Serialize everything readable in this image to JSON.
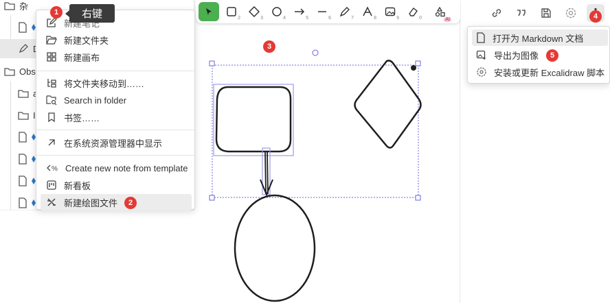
{
  "left_tree": {
    "rows": [
      {
        "label": "杂"
      },
      {
        "label": ""
      },
      {
        "label": "D"
      },
      {
        "label": "Obs"
      },
      {
        "label": "a"
      },
      {
        "label": "In"
      },
      {
        "label": ""
      },
      {
        "label": ""
      },
      {
        "label": ""
      },
      {
        "label": ""
      }
    ]
  },
  "tooltip": {
    "text": "右键"
  },
  "context_menu": {
    "items": [
      {
        "label": "新建笔记",
        "icon": "edit-icon"
      },
      {
        "label": "新建文件夹",
        "icon": "folder-open-icon"
      },
      {
        "label": "新建画布",
        "icon": "grid-icon"
      },
      {
        "label": "将文件夹移动到……",
        "icon": "move-folder-icon"
      },
      {
        "label": "Search in folder",
        "icon": "folder-search-icon"
      },
      {
        "label": "书签……",
        "icon": "bookmark-icon"
      },
      {
        "label": "在系统资源管理器中显示",
        "icon": "arrow-up-right-icon"
      },
      {
        "label": "Create new note from template",
        "icon": "template-icon"
      },
      {
        "label": "新看板",
        "icon": "kanban-icon"
      },
      {
        "label": "新建绘图文件",
        "icon": "excalidraw-icon"
      }
    ]
  },
  "toolbar": {
    "tools": [
      {
        "name": "selection-tool",
        "num": ""
      },
      {
        "name": "rectangle-tool",
        "num": "2"
      },
      {
        "name": "diamond-tool",
        "num": "3"
      },
      {
        "name": "ellipse-tool",
        "num": "4"
      },
      {
        "name": "arrow-tool",
        "num": "5"
      },
      {
        "name": "line-tool",
        "num": "6"
      },
      {
        "name": "pencil-tool",
        "num": "7"
      },
      {
        "name": "text-tool",
        "num": "8"
      },
      {
        "name": "image-tool",
        "num": "9"
      },
      {
        "name": "eraser-tool",
        "num": "0"
      },
      {
        "name": "ai-shapes-tool",
        "num": "AI"
      }
    ]
  },
  "more_menu": {
    "items": [
      {
        "label": "打开为 Markdown 文档",
        "icon": "file-icon"
      },
      {
        "label": "导出为图像",
        "icon": "image-export-icon"
      },
      {
        "label": "安装或更新 Excalidraw 脚本",
        "icon": "script-icon"
      }
    ]
  },
  "badges": [
    "1",
    "2",
    "3",
    "4",
    "5"
  ],
  "colors": {
    "accent": "#4caf50",
    "badge": "#e53935",
    "selection": "#6965db"
  }
}
